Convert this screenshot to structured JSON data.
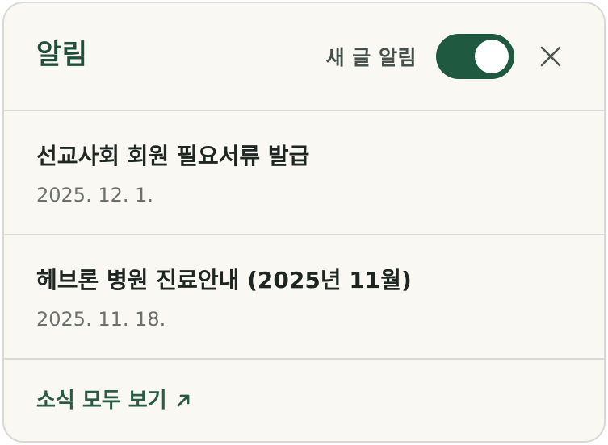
{
  "header": {
    "title": "알림",
    "toggle_label": "새 글 알림",
    "toggle_on": true,
    "close_icon": "close-icon"
  },
  "notifications": [
    {
      "title": "선교사회 회원 필요서류 발급",
      "date": "2025. 12. 1."
    },
    {
      "title": "헤브론 병원 진료안내 (2025년 11월)",
      "date": "2025. 11. 18."
    }
  ],
  "footer": {
    "link_label": "소식 모두 보기",
    "link_icon": "arrow-up-right-icon"
  },
  "colors": {
    "accent": "#1f5a40",
    "panel_bg": "#faf8f3",
    "border": "#d8dbd5"
  }
}
